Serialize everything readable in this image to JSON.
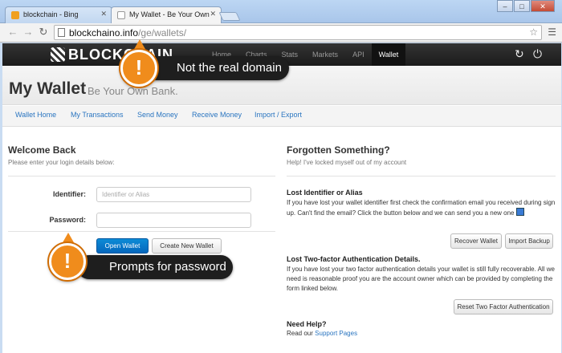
{
  "browser": {
    "tabs": [
      {
        "title": "blockchain - Bing",
        "favicon_color": "#f0a020"
      },
      {
        "title": "My Wallet - Be Your Own",
        "favicon_color": "#ffffff"
      }
    ],
    "window_controls": {
      "minimize": "–",
      "maximize": "□",
      "close": "✕"
    },
    "url_domain": "blockchaino.info",
    "url_path": "/ge/wallets/"
  },
  "navbar": {
    "logo_text": "BLOCKCHAIN",
    "links": [
      "Home",
      "Charts",
      "Stats",
      "Markets",
      "API",
      "Wallet"
    ],
    "active": "Wallet"
  },
  "header": {
    "title": "My Wallet",
    "tagline": "Be Your Own Bank."
  },
  "subnav": [
    "Wallet Home",
    "My Transactions",
    "Send Money",
    "Receive Money",
    "Import / Export"
  ],
  "login": {
    "title": "Welcome Back",
    "subtitle": "Please enter your login details below:",
    "identifier_label": "Identifier:",
    "identifier_placeholder": "Identifier or Alias",
    "password_label": "Password:",
    "open_button": "Open Wallet",
    "create_button": "Create New Wallet"
  },
  "forgotten": {
    "title": "Forgotten Something?",
    "subtitle": "Help! I've locked myself out of my account",
    "lost_id_title": "Lost Identifier or Alias",
    "lost_id_text": "If you have lost your wallet identifier first check the confirmation email you received during sign up. Can't find the email? Click the button below and we can send you a new one",
    "recover_button": "Recover Wallet",
    "import_button": "Import Backup",
    "lost_2fa_title": "Lost Two-factor Authentication Details.",
    "lost_2fa_text": "If you have lost your two factor authentication details your wallet is still fully recoverable. All we need is reasonable proof you are the account owner which can be provided by completing the form linked below.",
    "reset_button": "Reset Two Factor Authentication",
    "help_title": "Need Help?",
    "help_text": "Read our",
    "help_link": "Support Pages"
  },
  "annotations": {
    "callout_1": "Not the real domain",
    "callout_2": "Prompts for password",
    "badge_symbol": "!",
    "badge_color": "#f08c1c"
  }
}
